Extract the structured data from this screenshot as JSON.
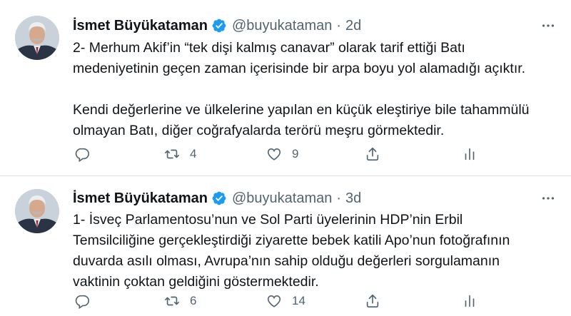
{
  "tweets": [
    {
      "name": "İsmet Büyükataman",
      "handle": "@buyukataman",
      "separator": "·",
      "time": "2d",
      "lines": [
        "2- Merhum Akif’in “tek dişi kalmış canavar” olarak tarif ettiği Batı",
        "medeniyetinin geçen zaman içerisinde bir arpa boyu yol alamadığı açıktır.",
        "",
        "Kendi değerlerine ve ülkelerine yapılan en küçük eleştiriye bile tahammülü",
        "olmayan Batı, diğer coğrafyalarda terörü meşru görmektedir."
      ],
      "retweets": "4",
      "likes": "9"
    },
    {
      "name": "İsmet Büyükataman",
      "handle": "@buyukataman",
      "separator": "·",
      "time": "3d",
      "lines": [
        "1- İsveç Parlamentosu’nun ve Sol Parti üyelerinin HDP’nin Erbil",
        "Temsilciliğine gerçekleştirdiği ziyarette bebek katili Apo’nun fotoğrafının",
        "duvarda asılı olması, Avrupa’nın sahip olduğu değerleri sorgulamanın",
        "vaktinin çoktan geldiğini göstermektedir."
      ],
      "retweets": "6",
      "likes": "14"
    }
  ],
  "icons": {
    "verified": "verified-badge-icon",
    "more": "more-options-icon",
    "reply": "reply-icon",
    "retweet": "retweet-icon",
    "like": "heart-icon",
    "share": "share-icon",
    "stats": "analytics-icon"
  },
  "colors": {
    "verified_blue": "#1d9bf0",
    "text": "#0f1419",
    "secondary": "#536471",
    "divider": "#dfe3e6"
  }
}
